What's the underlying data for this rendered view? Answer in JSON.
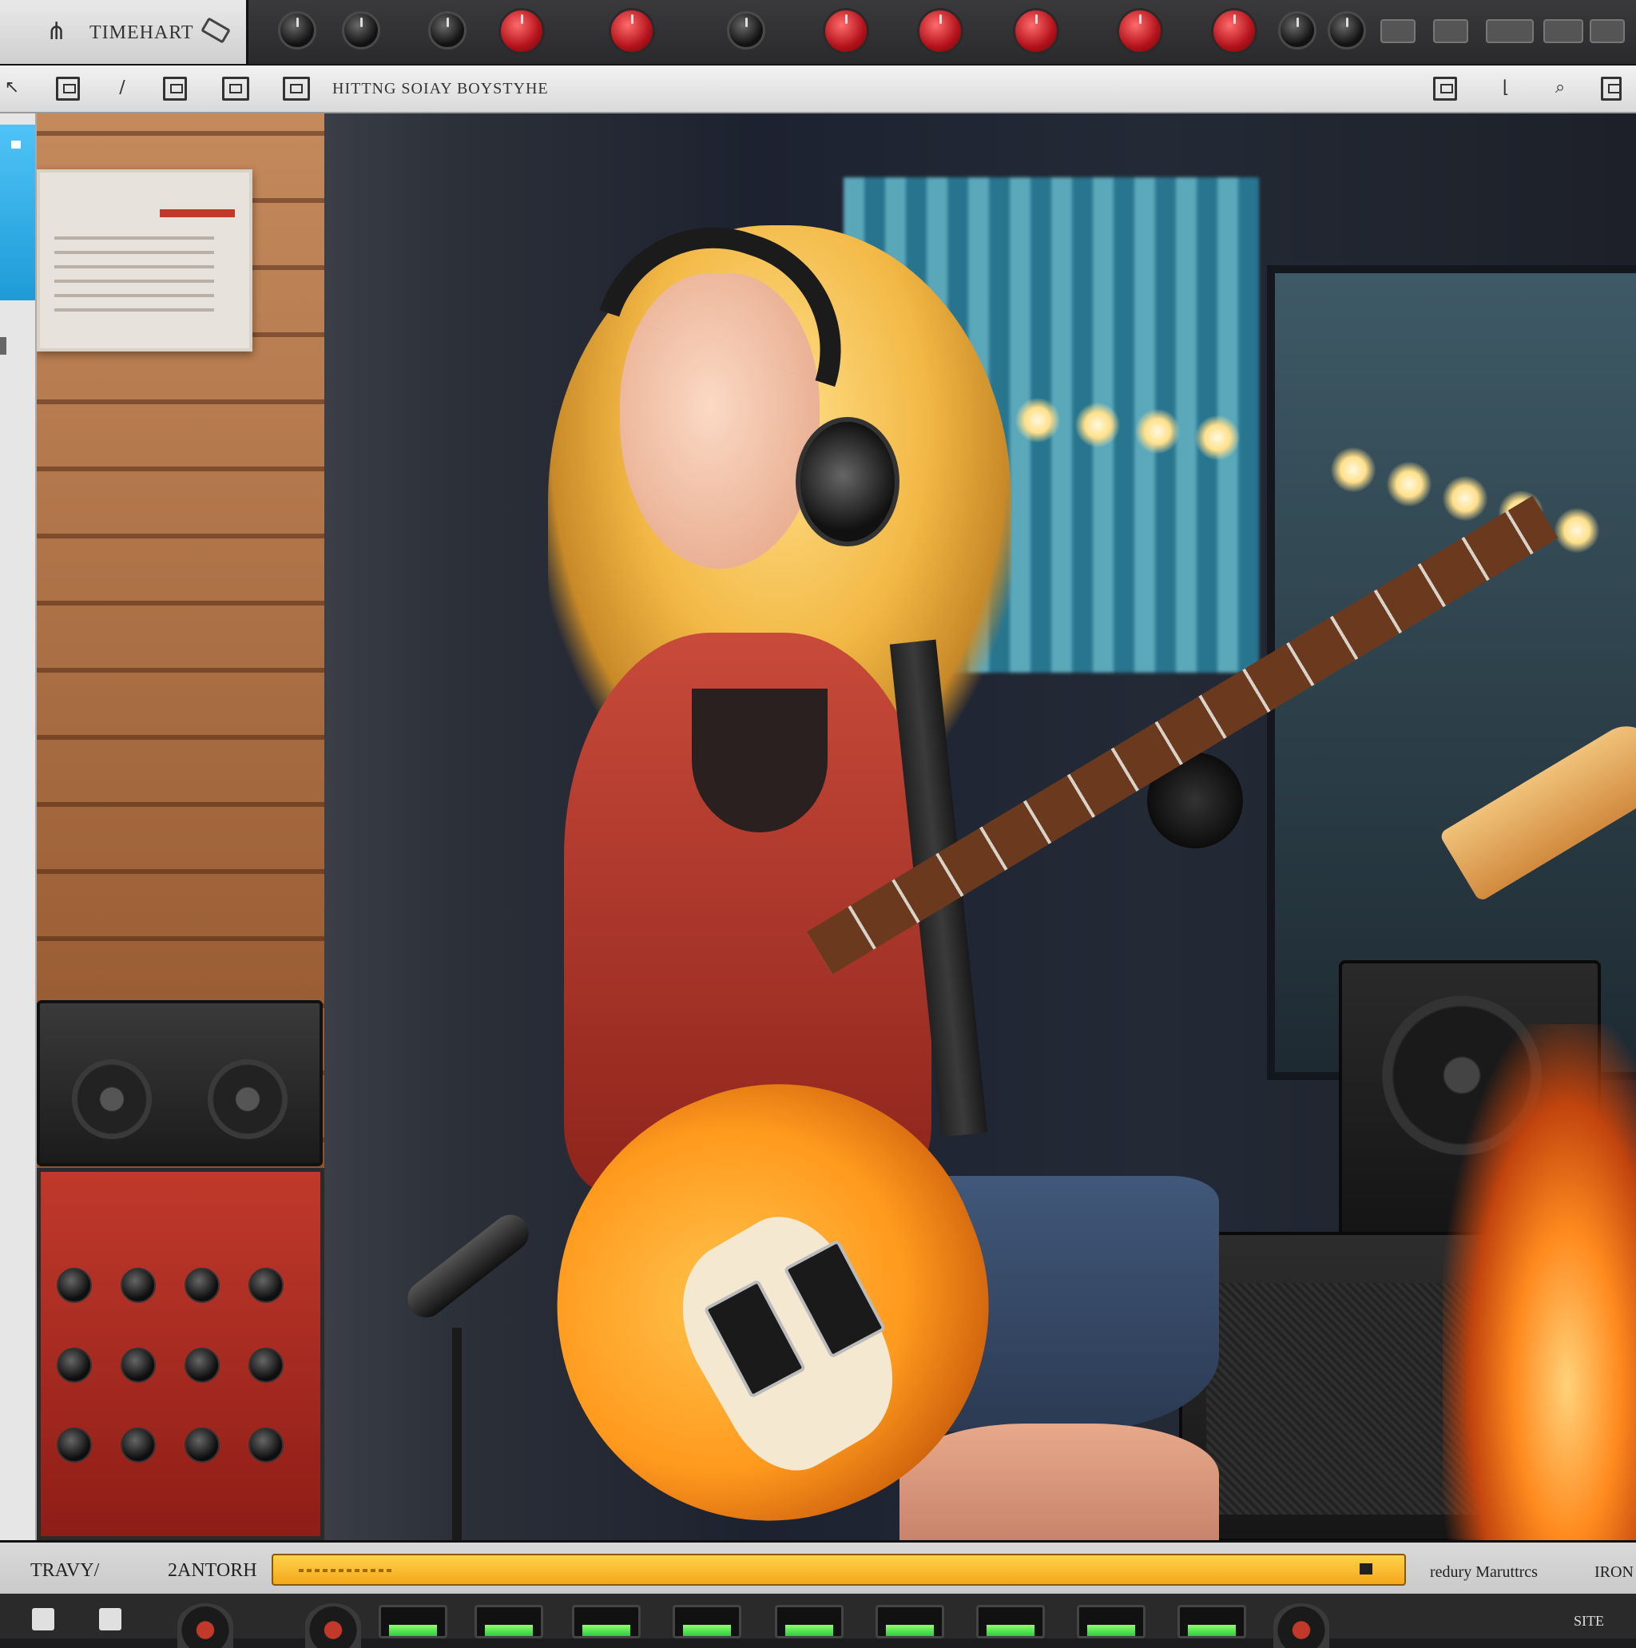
{
  "app": {
    "title": "TIMEHART"
  },
  "toolbar": {
    "project_title": "HITTNG SOIAY BOYSTYHE"
  },
  "top_controls": {
    "knob_labels": [
      "",
      "",
      ""
    ],
    "buttons": [
      "",
      "",
      "",
      "",
      ""
    ]
  },
  "bottom_bar": {
    "label_left": "TRAVY/",
    "label_time": "2ANTORH",
    "label_right": "redury Maruttrcs",
    "label_far_right": "IRON",
    "label_corner": "SITE"
  },
  "colors": {
    "accent_red": "#c0392b",
    "timeline_yellow": "#f4a81c",
    "meter_green": "#2ecc40",
    "panel_dark": "#2a2a2c",
    "panel_light": "#e0e0e0"
  },
  "icons": {
    "logo": "tuning-fork-icon",
    "toolbar": [
      "back-arrow-icon",
      "frame-icon",
      "pencil-icon",
      "image-icon",
      "panel-icon",
      "panel-icon",
      "window-icon",
      "crop-icon",
      "search-icon",
      "export-icon"
    ]
  }
}
